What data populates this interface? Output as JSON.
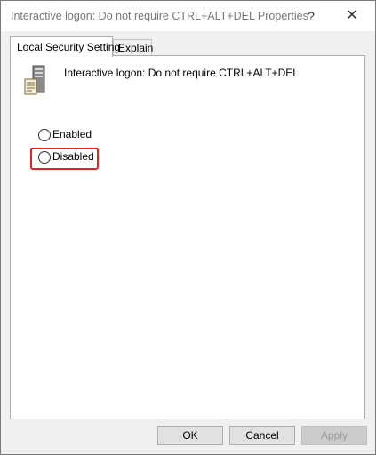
{
  "window": {
    "title": "Interactive logon: Do not require CTRL+ALT+DEL Properties",
    "help_label": "?",
    "close_label": "✕"
  },
  "tabs": [
    {
      "label": "Local Security Setting",
      "selected": true
    },
    {
      "label": "Explain",
      "selected": false
    }
  ],
  "policy": {
    "icon": "server-policy-icon",
    "name": "Interactive logon: Do not require CTRL+ALT+DEL"
  },
  "options": [
    {
      "label": "Enabled",
      "selected": false
    },
    {
      "label": "Disabled",
      "selected": false,
      "highlighted": true
    }
  ],
  "buttons": {
    "ok": "OK",
    "cancel": "Cancel",
    "apply": "Apply",
    "apply_enabled": false
  },
  "colors": {
    "highlight": "#e02424",
    "window_bg": "#f0f0f0",
    "title_text": "#777777"
  }
}
